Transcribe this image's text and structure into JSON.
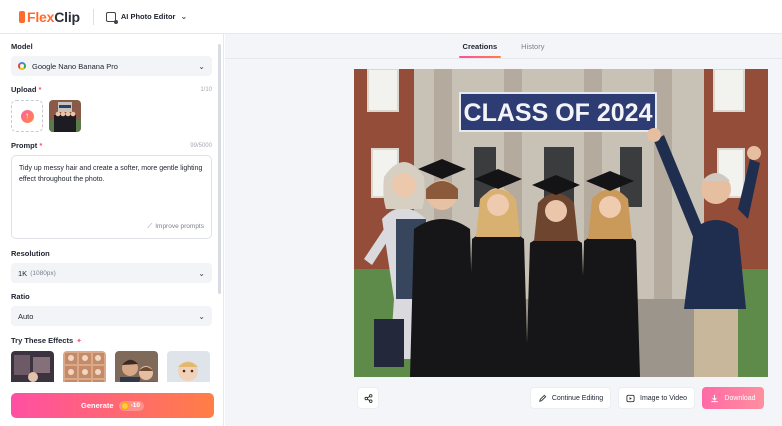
{
  "header": {
    "logo_flex": "Flex",
    "logo_clip": "Clip",
    "tool_name": "AI Photo Editor"
  },
  "left_panel": {
    "model": {
      "label": "Model",
      "value": "Google Nano Banana Pro"
    },
    "upload": {
      "label": "Upload",
      "required_mark": "*",
      "count": "1/10"
    },
    "prompt": {
      "label": "Prompt",
      "required_mark": "*",
      "count": "99/5000",
      "text": "Tidy up messy hair and create a softer, more gentle lighting effect throughout the photo.",
      "improve_label": "Improve prompts"
    },
    "resolution": {
      "label": "Resolution",
      "value": "1K",
      "sub": "(1080px)"
    },
    "ratio": {
      "label": "Ratio",
      "value": "Auto"
    },
    "effects": {
      "label": "Try These Effects"
    },
    "generate": {
      "label": "Generate",
      "cost": "-10"
    }
  },
  "main": {
    "tabs": [
      {
        "label": "Creations",
        "active": true
      },
      {
        "label": "History",
        "active": false
      }
    ],
    "photo": {
      "banner_text": "CLASS OF 2024"
    },
    "actions": {
      "continue_editing": "Continue Editing",
      "image_to_video": "Image to Video",
      "download": "Download"
    }
  },
  "colors": {
    "brand_orange": "#ff6b2c",
    "gradient_start": "#ff4fa3",
    "gradient_end": "#ff7e45",
    "panel_bg": "#f4f5f8"
  }
}
